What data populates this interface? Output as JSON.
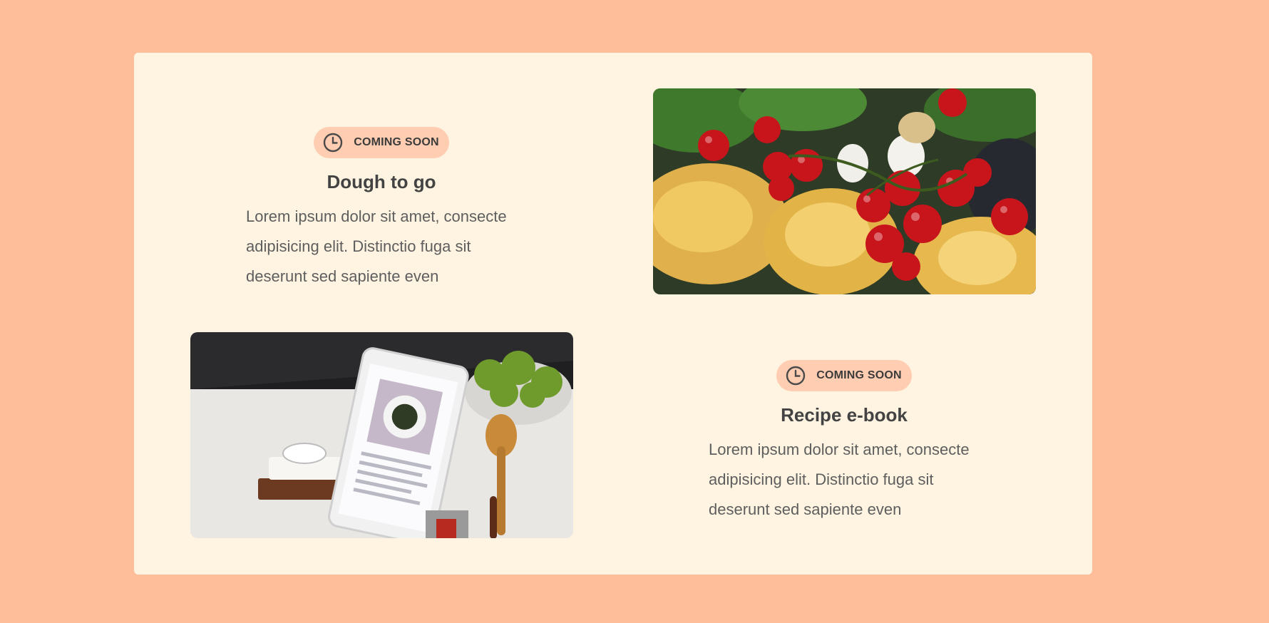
{
  "features": [
    {
      "badge": "COMING SOON",
      "title": "Dough to go",
      "description": "Lorem ipsum dolor sit amet, consecte adipisicing elit. Distinctio fuga sit deserunt sed sapiente even",
      "image_icon": "pasta-tomatoes-photo"
    },
    {
      "badge": "COMING SOON",
      "title": "Recipe e-book",
      "description": "Lorem ipsum dolor sit amet, consecte adipisicing elit. Distinctio fuga sit deserunt sed sapiente even",
      "image_icon": "tablet-recipe-photo"
    }
  ],
  "colors": {
    "background": "#ffbe9a",
    "card": "#fff4e1",
    "badge": "#ffcdb2",
    "heading": "#434343",
    "body_text": "#5e5e5e"
  },
  "icons": {
    "badge_icon": "clock-icon"
  }
}
